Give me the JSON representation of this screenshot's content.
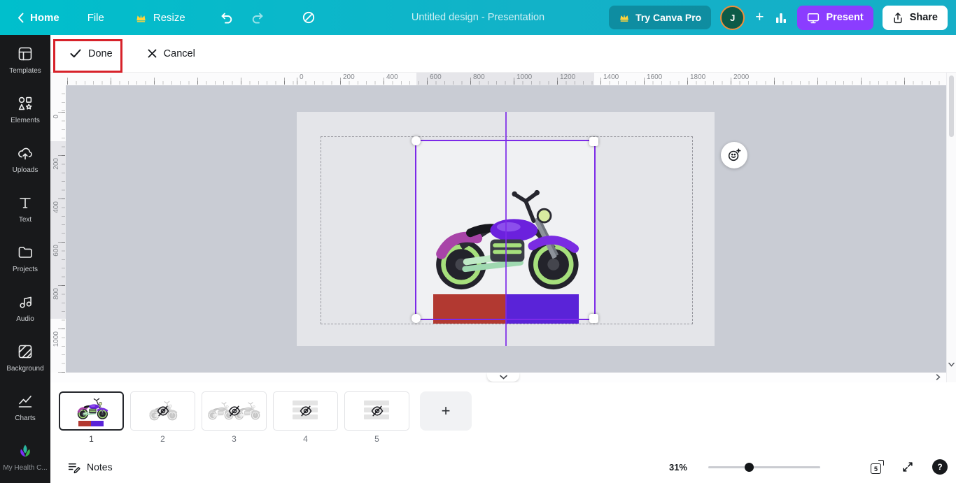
{
  "colors": {
    "topbar_teal": "#12b2c8",
    "present_purple": "#8b3dff",
    "selection_purple": "#7c2ae8",
    "annotation_red": "#d7222a",
    "red_block": "#b23931",
    "purple_block": "#5a23d8"
  },
  "topbar": {
    "home_label": "Home",
    "file_label": "File",
    "resize_label": "Resize",
    "title": "Untitled design - Presentation",
    "try_pro_label": "Try Canva Pro",
    "avatar_initial": "J",
    "add_label": "+",
    "present_label": "Present",
    "share_label": "Share"
  },
  "editbar": {
    "done_label": "Done",
    "cancel_label": "Cancel"
  },
  "sidebar": {
    "items": [
      {
        "label": "Templates"
      },
      {
        "label": "Elements"
      },
      {
        "label": "Uploads"
      },
      {
        "label": "Text"
      },
      {
        "label": "Projects"
      },
      {
        "label": "Audio"
      },
      {
        "label": "Background"
      },
      {
        "label": "Charts"
      },
      {
        "label": "My Health C..."
      }
    ]
  },
  "rulers": {
    "horizontal": [
      "0",
      "200",
      "400",
      "600",
      "800",
      "1000",
      "1200",
      "1400",
      "1600",
      "1800",
      "2000"
    ],
    "vertical": [
      "0",
      "200",
      "400",
      "600",
      "800",
      "1000"
    ]
  },
  "canvas": {
    "image_name": "motorcycle-illustration"
  },
  "pages_strip": {
    "add_label": "+",
    "pages": [
      {
        "number": "1"
      },
      {
        "number": "2"
      },
      {
        "number": "3"
      },
      {
        "number": "4"
      },
      {
        "number": "5"
      }
    ]
  },
  "statusbar": {
    "notes_label": "Notes",
    "zoom_value": "31%",
    "page_count": "5",
    "help_label": "?"
  }
}
